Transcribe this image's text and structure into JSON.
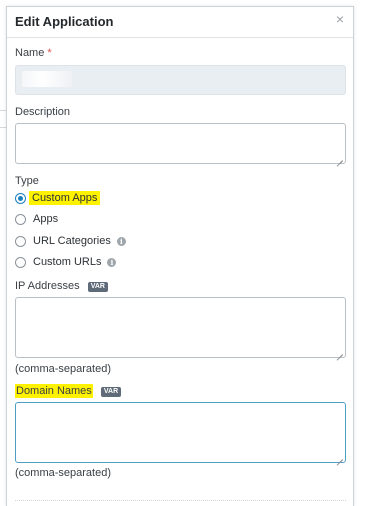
{
  "dialog": {
    "title": "Edit Application",
    "close_glyph": "×"
  },
  "name_field": {
    "label": "Name",
    "required_mark": "*",
    "value_redacted": true
  },
  "description_field": {
    "label": "Description",
    "value": ""
  },
  "type_field": {
    "label": "Type",
    "selected": "Custom Apps",
    "options": [
      {
        "label": "Custom Apps",
        "checked": true,
        "highlighted": true,
        "info": false
      },
      {
        "label": "Apps",
        "checked": false,
        "highlighted": false,
        "info": false
      },
      {
        "label": "URL Categories",
        "checked": false,
        "highlighted": false,
        "info": true
      },
      {
        "label": "Custom URLs",
        "checked": false,
        "highlighted": false,
        "info": true
      }
    ]
  },
  "ip_field": {
    "label": "IP Addresses",
    "badge": "VAR",
    "value": "",
    "hint": "(comma-separated)"
  },
  "domain_field": {
    "label": "Domain Names",
    "badge": "VAR",
    "value": "",
    "hint": "(comma-separated)",
    "highlighted": true
  },
  "icons": {
    "close": "close-icon",
    "info": "info-icon"
  },
  "colors": {
    "highlight": "#fff200",
    "radio_selected": "#1c7fc0",
    "badge": "#5f6b78",
    "required": "#d9534f"
  }
}
